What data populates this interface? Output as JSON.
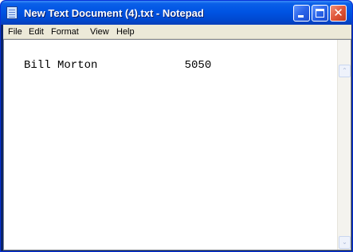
{
  "window": {
    "title": "New Text Document (4).txt - Notepad",
    "close_glyph": "✕"
  },
  "menu": {
    "items": [
      "File",
      "Edit",
      "Format",
      "View",
      "Help"
    ]
  },
  "document": {
    "content": "Bill Morton             5050"
  },
  "scrollbar": {
    "up_arrow": "⌃",
    "down_arrow": "⌄"
  },
  "colors": {
    "titlebar": "#0054e3",
    "menubar": "#ece9d8",
    "close_button": "#e0563a"
  }
}
